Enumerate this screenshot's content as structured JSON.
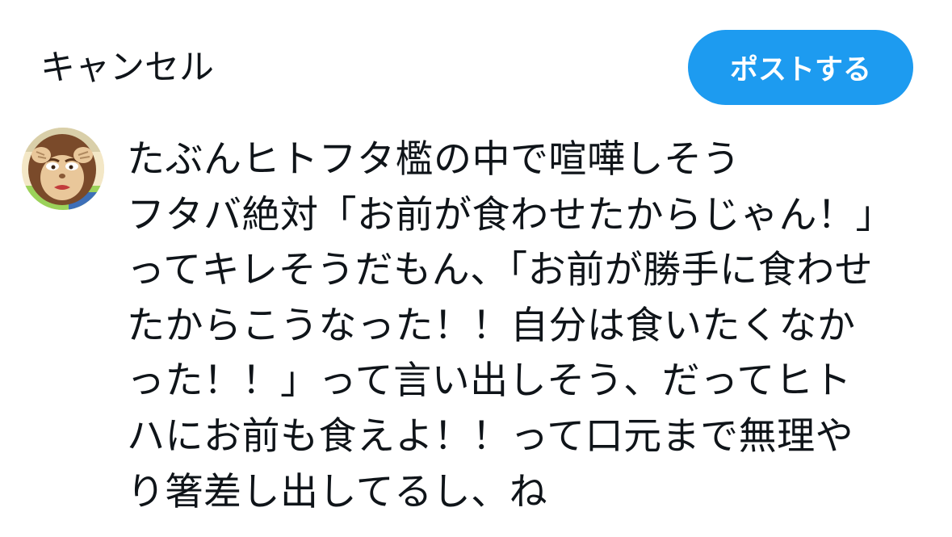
{
  "header": {
    "cancel_label": "キャンセル",
    "post_label": "ポストする"
  },
  "colors": {
    "accent": "#1d9bf0",
    "text": "#0f1419",
    "background": "#ffffff"
  },
  "composer": {
    "avatar_icon": "monkey-avatar-icon",
    "lines": [
      "たぶんヒトフタ檻の中で喧嘩しそう",
      "フタバ絶対「お前が食わせたからじゃん！」",
      "ってキレそうだもん、「お前が勝手に食わせ",
      "たからこうなった！！自分は食いたくなか",
      "った！！」って言い出しそう、だってヒト",
      "ハにお前も食えよ！！って口元まで無理や",
      "り箸差し出してるし、ね"
    ]
  }
}
